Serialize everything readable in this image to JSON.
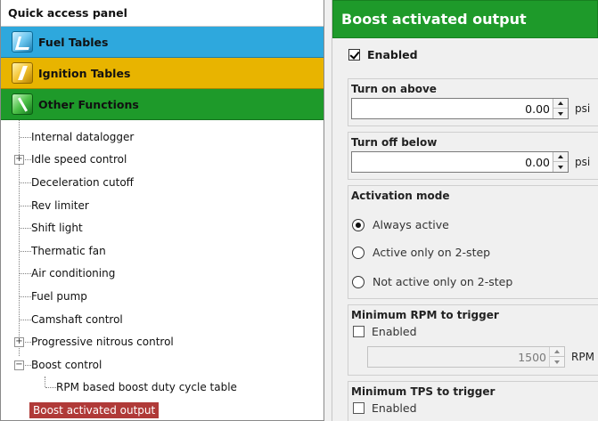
{
  "quick_access": {
    "title": "Quick access panel",
    "categories": [
      {
        "label": "Fuel Tables",
        "color": "#2ea8dd",
        "icon": "fuel-tables-icon"
      },
      {
        "label": "Ignition Tables",
        "color": "#e8b400",
        "icon": "ignition-tables-icon"
      },
      {
        "label": "Other Functions",
        "color": "#1e9a2a",
        "icon": "other-functions-icon"
      }
    ],
    "tree": [
      {
        "label": "Internal datalogger",
        "expandable": false
      },
      {
        "label": "Idle speed control",
        "expandable": true,
        "expander": "+"
      },
      {
        "label": "Deceleration cutoff",
        "expandable": false
      },
      {
        "label": "Rev limiter",
        "expandable": false
      },
      {
        "label": "Shift light",
        "expandable": false
      },
      {
        "label": "Thermatic fan",
        "expandable": false
      },
      {
        "label": "Air conditioning",
        "expandable": false
      },
      {
        "label": "Fuel pump",
        "expandable": false
      },
      {
        "label": "Camshaft control",
        "expandable": false
      },
      {
        "label": "Progressive nitrous control",
        "expandable": true,
        "expander": "+"
      },
      {
        "label": "Boost control",
        "expandable": true,
        "expander": "−"
      },
      {
        "label": "RPM based boost duty cycle table",
        "child": true
      },
      {
        "label": "Boost activated output",
        "selected": true,
        "highlight": "#b03a38"
      }
    ]
  },
  "settings": {
    "header": "Boost activated output",
    "header_color": "#1e9a2a",
    "enabled": {
      "label": "Enabled",
      "checked": true
    },
    "turn_on_above": {
      "title": "Turn on above",
      "value": "0.00",
      "unit": "psi"
    },
    "turn_off_below": {
      "title": "Turn off below",
      "value": "0.00",
      "unit": "psi"
    },
    "activation_mode": {
      "title": "Activation mode",
      "options": [
        {
          "label": "Always active",
          "selected": true
        },
        {
          "label": "Active only on 2-step",
          "selected": false
        },
        {
          "label": "Not active only on 2-step",
          "selected": false
        }
      ]
    },
    "min_rpm": {
      "title": "Minimum RPM to trigger",
      "enabled_label": "Enabled",
      "checked": false,
      "value": "1500",
      "unit": "RPM"
    },
    "min_tps": {
      "title": "Minimum TPS to trigger",
      "enabled_label": "Enabled",
      "checked": false
    }
  }
}
